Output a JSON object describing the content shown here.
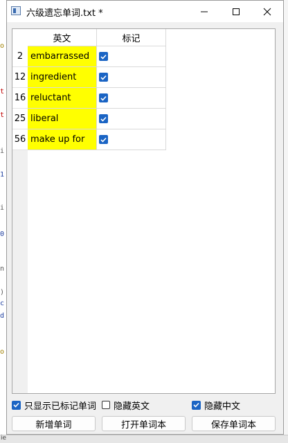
{
  "window": {
    "title": "六级遗忘单词.txt *"
  },
  "background": {
    "bottom_fragment": "ie"
  },
  "table": {
    "headers": [
      "英文",
      "标记"
    ],
    "rows": [
      {
        "num": "2",
        "english": "embarrassed",
        "marked": true
      },
      {
        "num": "12",
        "english": "ingredient",
        "marked": true
      },
      {
        "num": "16",
        "english": "reluctant",
        "marked": true
      },
      {
        "num": "25",
        "english": "liberal",
        "marked": true
      },
      {
        "num": "56",
        "english": "make up for",
        "marked": true
      }
    ],
    "highlight_color": "#ffff00"
  },
  "options": {
    "show_marked_only": {
      "label": "只显示已标记单词",
      "checked": true
    },
    "hide_english": {
      "label": "隐藏英文",
      "checked": false
    },
    "hide_chinese": {
      "label": "隐藏中文",
      "checked": true
    }
  },
  "buttons": {
    "add": "新增单词",
    "open": "打开单词本",
    "save": "保存单词本"
  },
  "colors": {
    "accent": "#1a64c4"
  }
}
